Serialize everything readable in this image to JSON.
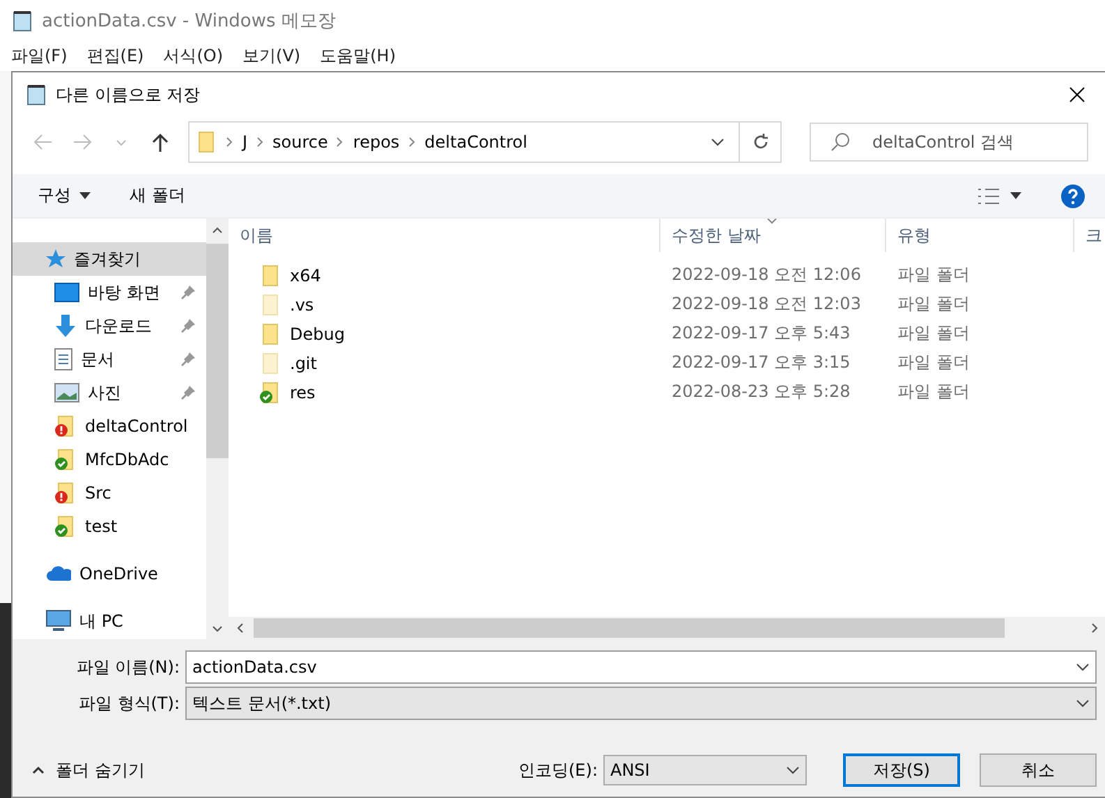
{
  "notepad": {
    "title": "actionData.csv - Windows 메모장",
    "menu": [
      "파일(F)",
      "편집(E)",
      "서식(O)",
      "보기(V)",
      "도움말(H)"
    ]
  },
  "dialog": {
    "title": "다른 이름으로 저장",
    "path": [
      "J",
      "source",
      "repos",
      "deltaControl"
    ],
    "search": {
      "placeholder": "deltaControl 검색"
    },
    "toolbar": {
      "organize": "구성",
      "new_folder": "새 폴더"
    },
    "sidebar": [
      {
        "kind": "favorites",
        "label": "즐겨찾기",
        "selected": true,
        "pinned": false
      },
      {
        "kind": "desktop",
        "label": "바탕 화면",
        "selected": false,
        "pinned": true
      },
      {
        "kind": "downloads",
        "label": "다운로드",
        "selected": false,
        "pinned": true
      },
      {
        "kind": "documents",
        "label": "문서",
        "selected": false,
        "pinned": true
      },
      {
        "kind": "pictures",
        "label": "사진",
        "selected": false,
        "pinned": true
      },
      {
        "kind": "folder-error",
        "label": "deltaControl",
        "selected": false,
        "pinned": false
      },
      {
        "kind": "folder-ok",
        "label": "MfcDbAdc",
        "selected": false,
        "pinned": false
      },
      {
        "kind": "folder-error",
        "label": "Src",
        "selected": false,
        "pinned": false
      },
      {
        "kind": "folder-ok",
        "label": "test",
        "selected": false,
        "pinned": false
      },
      {
        "kind": "onedrive",
        "label": "OneDrive",
        "selected": false,
        "pinned": false
      },
      {
        "kind": "pc",
        "label": "내 PC",
        "selected": false,
        "pinned": false
      }
    ],
    "columns": [
      "이름",
      "수정한 날짜",
      "유형",
      "크"
    ],
    "files": [
      {
        "kind": "folder",
        "name": "x64",
        "date": "2022-09-18 오전 12:06",
        "type": "파일 폴더"
      },
      {
        "kind": "hidden",
        "name": ".vs",
        "date": "2022-09-18 오전 12:03",
        "type": "파일 폴더"
      },
      {
        "kind": "folder",
        "name": "Debug",
        "date": "2022-09-17 오후 5:43",
        "type": "파일 폴더"
      },
      {
        "kind": "hidden",
        "name": ".git",
        "date": "2022-09-17 오후 3:15",
        "type": "파일 폴더"
      },
      {
        "kind": "folder-ok",
        "name": "res",
        "date": "2022-08-23 오후 5:28",
        "type": "파일 폴더"
      }
    ],
    "filename": {
      "label": "파일 이름(N):",
      "value": "actionData.csv"
    },
    "filetype": {
      "label": "파일 형식(T):",
      "value": "텍스트 문서(*.txt)"
    },
    "hide_folders": "폴더 숨기기",
    "encoding": {
      "label": "인코딩(E):",
      "value": "ANSI"
    },
    "buttons": [
      "저장(S)",
      "취소"
    ]
  }
}
